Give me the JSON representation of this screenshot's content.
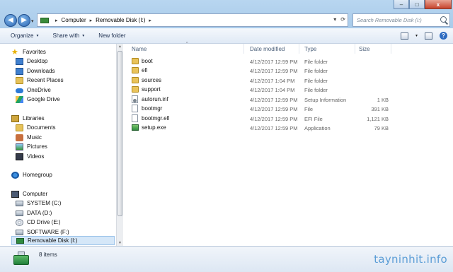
{
  "window": {
    "controls": {
      "minimize": "–",
      "maximize": "□",
      "close": "x"
    }
  },
  "address": {
    "crumbs": [
      "Computer",
      "Removable Disk (I:)"
    ],
    "separator": "▸"
  },
  "search": {
    "placeholder": "Search Removable Disk (I:)"
  },
  "toolbar": {
    "organize": "Organize",
    "share_with": "Share with",
    "new_folder": "New folder",
    "caret": "▾"
  },
  "navpane": {
    "favorites": {
      "label": "Favorites",
      "items": [
        "Desktop",
        "Downloads",
        "Recent Places",
        "OneDrive",
        "Google Drive"
      ]
    },
    "libraries": {
      "label": "Libraries",
      "items": [
        "Documents",
        "Music",
        "Pictures",
        "Videos"
      ]
    },
    "homegroup": {
      "label": "Homegroup"
    },
    "computer": {
      "label": "Computer",
      "items": [
        "SYSTEM (C:)",
        "DATA (D:)",
        "CD Drive (E:)",
        "SOFTWARE (F:)",
        "Removable Disk (I:)"
      ]
    }
  },
  "columns": {
    "name": "Name",
    "date": "Date modified",
    "type": "Type",
    "size": "Size"
  },
  "files": [
    {
      "name": "boot",
      "date": "4/12/2017 12:59 PM",
      "type": "File folder",
      "size": "",
      "icon": "folder-icon"
    },
    {
      "name": "efi",
      "date": "4/12/2017 12:59 PM",
      "type": "File folder",
      "size": "",
      "icon": "folder-icon"
    },
    {
      "name": "sources",
      "date": "4/12/2017 1:04 PM",
      "type": "File folder",
      "size": "",
      "icon": "folder-icon"
    },
    {
      "name": "support",
      "date": "4/12/2017 1:04 PM",
      "type": "File folder",
      "size": "",
      "icon": "folder-icon"
    },
    {
      "name": "autorun.inf",
      "date": "4/12/2017 12:59 PM",
      "type": "Setup Information",
      "size": "1 KB",
      "icon": "settings-file-icon"
    },
    {
      "name": "bootmgr",
      "date": "4/12/2017 12:59 PM",
      "type": "File",
      "size": "391 KB",
      "icon": "file-icon"
    },
    {
      "name": "bootmgr.efi",
      "date": "4/12/2017 12:59 PM",
      "type": "EFI File",
      "size": "1,121 KB",
      "icon": "file-icon"
    },
    {
      "name": "setup.exe",
      "date": "4/12/2017 12:59 PM",
      "type": "Application",
      "size": "79 KB",
      "icon": "application-icon"
    }
  ],
  "status": {
    "count": "8 items"
  },
  "watermark": "tayninhit.info"
}
